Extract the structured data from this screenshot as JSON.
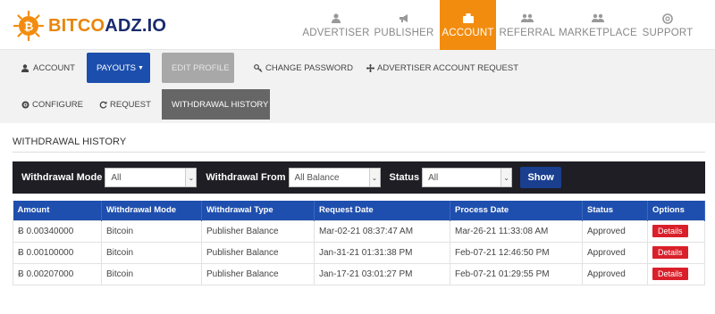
{
  "brand": {
    "part1": "BITCO",
    "part2": "ADZ.IO"
  },
  "nav": [
    {
      "label": "ADVERTISER",
      "icon": "user-icon"
    },
    {
      "label": "PUBLISHER",
      "icon": "megaphone-icon"
    },
    {
      "label": "ACCOUNT",
      "icon": "briefcase-icon",
      "active": true
    },
    {
      "label": "REFERRAL",
      "icon": "users-icon"
    },
    {
      "label": "MARKETPLACE",
      "icon": "users-icon"
    },
    {
      "label": "SUPPORT",
      "icon": "lifebuoy-icon"
    }
  ],
  "subnav1": {
    "account": "ACCOUNT",
    "payouts": "PAYOUTS",
    "edit_profile": "EDIT PROFILE",
    "change_password": "CHANGE PASSWORD",
    "advertiser_request": "ADVERTISER ACCOUNT REQUEST"
  },
  "subnav2": {
    "configure": "CONFIGURE",
    "request": "REQUEST",
    "history": "WITHDRAWAL HISTORY"
  },
  "page_title": "WITHDRAWAL HISTORY",
  "filters": {
    "mode_label": "Withdrawal Mode",
    "mode_value": "All",
    "from_label": "Withdrawal From",
    "from_value": "All Balance",
    "status_label": "Status",
    "status_value": "All",
    "show_label": "Show"
  },
  "table": {
    "headers": [
      "Amount",
      "Withdrawal Mode",
      "Withdrawal Type",
      "Request Date",
      "Process Date",
      "Status",
      "Options"
    ],
    "rows": [
      [
        "Ƀ 0.00340000",
        "Bitcoin",
        "Publisher Balance",
        "Mar-02-21 08:37:47 AM",
        "Mar-26-21 11:33:08 AM",
        "Approved",
        "Details"
      ],
      [
        "Ƀ 0.00100000",
        "Bitcoin",
        "Publisher Balance",
        "Jan-31-21 01:31:38 PM",
        "Feb-07-21 12:46:50 PM",
        "Approved",
        "Details"
      ],
      [
        "Ƀ 0.00207000",
        "Bitcoin",
        "Publisher Balance",
        "Jan-17-21 03:01:27 PM",
        "Feb-07-21 01:29:55 PM",
        "Approved",
        "Details"
      ]
    ]
  },
  "colors": {
    "accent": "#f28c0f",
    "primary": "#1f4fae",
    "danger": "#d9202a",
    "dark": "#1e1e24"
  }
}
